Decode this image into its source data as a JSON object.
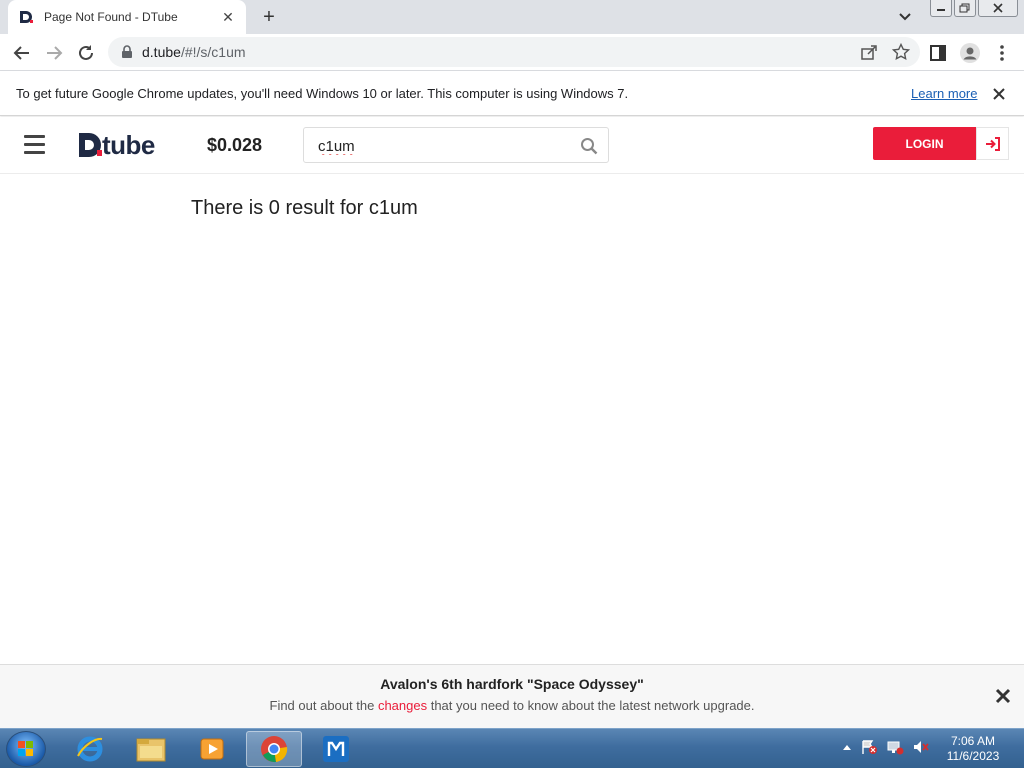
{
  "browser": {
    "tab_title": "Page Not Found - DTube",
    "url_host": "d.tube",
    "url_path": "/#!/s/c1um"
  },
  "infobar": {
    "message": "To get future Google Chrome updates, you'll need Windows 10 or later. This computer is using Windows 7.",
    "link": "Learn more"
  },
  "dtube": {
    "logo": "D.tube",
    "price": "$0.028",
    "search_value": "c1um",
    "login_label": "LOGIN",
    "result_text": "There is 0 result for c1um"
  },
  "banner": {
    "title": "Avalon's 6th hardfork \"Space Odyssey\"",
    "sub_before": "Find out about the",
    "sub_link": "changes",
    "sub_after": "that you need to know about the latest network upgrade."
  },
  "taskbar": {
    "time": "7:06 AM",
    "date": "11/6/2023"
  },
  "colors": {
    "accent": "#ea1d3a",
    "logo": "#1f2a44",
    "link": "#1a5fb4"
  }
}
